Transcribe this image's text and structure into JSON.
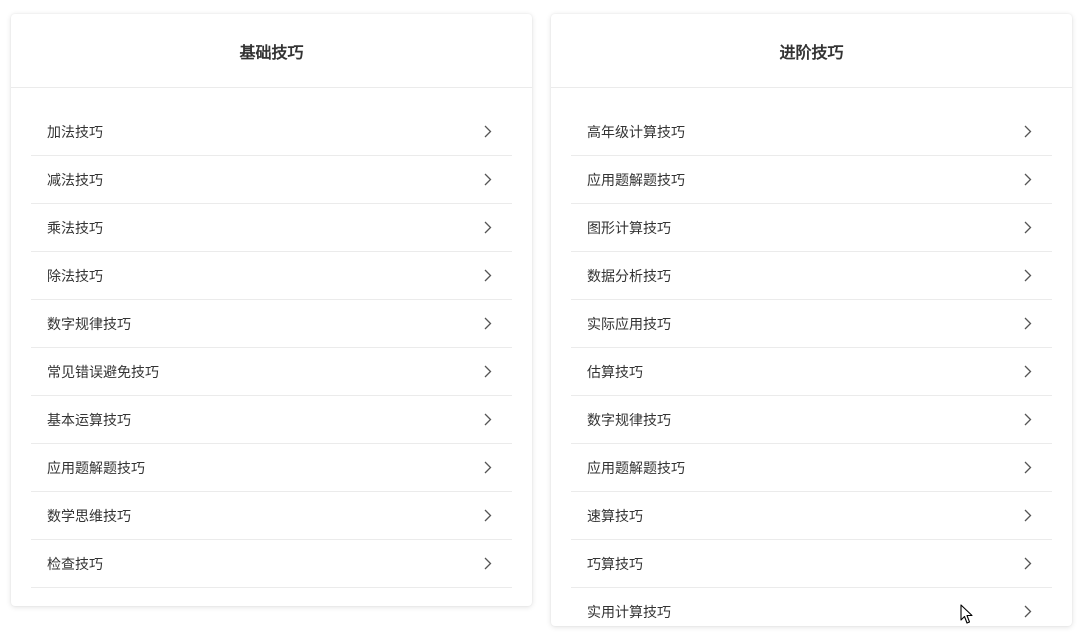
{
  "left_panel": {
    "title": "基础技巧",
    "items": [
      {
        "label": "加法技巧",
        "icon": "chevron-right-icon"
      },
      {
        "label": "减法技巧",
        "icon": "chevron-right-icon"
      },
      {
        "label": "乘法技巧",
        "icon": "chevron-right-icon"
      },
      {
        "label": "除法技巧",
        "icon": "chevron-right-icon"
      },
      {
        "label": "数字规律技巧",
        "icon": "chevron-right-icon"
      },
      {
        "label": "常见错误避免技巧",
        "icon": "chevron-right-icon"
      },
      {
        "label": "基本运算技巧",
        "icon": "chevron-right-icon"
      },
      {
        "label": "应用题解题技巧",
        "icon": "chevron-right-icon"
      },
      {
        "label": "数学思维技巧",
        "icon": "chevron-right-icon"
      },
      {
        "label": "检查技巧",
        "icon": "chevron-right-icon"
      }
    ]
  },
  "right_panel": {
    "title": "进阶技巧",
    "items": [
      {
        "label": "高年级计算技巧",
        "icon": "chevron-right-icon"
      },
      {
        "label": "应用题解题技巧",
        "icon": "chevron-right-icon"
      },
      {
        "label": "图形计算技巧",
        "icon": "chevron-right-icon"
      },
      {
        "label": "数据分析技巧",
        "icon": "chevron-right-icon"
      },
      {
        "label": "实际应用技巧",
        "icon": "chevron-right-icon"
      },
      {
        "label": "估算技巧",
        "icon": "chevron-right-icon"
      },
      {
        "label": "数字规律技巧",
        "icon": "chevron-right-icon"
      },
      {
        "label": "应用题解题技巧",
        "icon": "chevron-right-icon"
      },
      {
        "label": "速算技巧",
        "icon": "chevron-right-icon"
      },
      {
        "label": "巧算技巧",
        "icon": "chevron-right-icon"
      },
      {
        "label": "实用计算技巧",
        "icon": "chevron-right-icon"
      }
    ]
  },
  "colors": {
    "text": "#333333",
    "divider": "#ebebeb",
    "chevron": "#555555",
    "background": "#ffffff"
  }
}
